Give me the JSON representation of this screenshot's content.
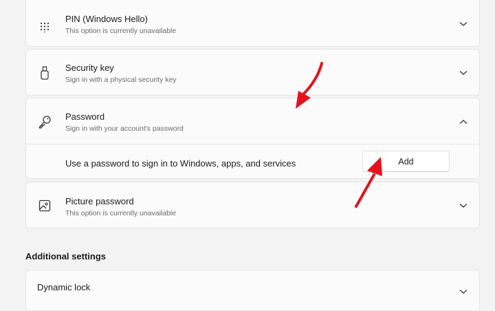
{
  "sign_in_options": [
    {
      "title": "PIN (Windows Hello)",
      "subtitle": "This option is currently unavailable",
      "icon": "keypad-icon",
      "expanded": false
    },
    {
      "title": "Security key",
      "subtitle": "Sign in with a physical security key",
      "icon": "usb-key-icon",
      "expanded": false
    },
    {
      "title": "Password",
      "subtitle": "Sign in with your account's password",
      "icon": "key-icon",
      "expanded": true
    },
    {
      "title": "Picture password",
      "subtitle": "This option is currently unavailable",
      "icon": "picture-icon",
      "expanded": false
    }
  ],
  "password_panel": {
    "description": "Use a password to sign in to Windows, apps, and services",
    "add_label": "Add"
  },
  "additional_settings": {
    "heading": "Additional settings",
    "items": [
      {
        "title": "Dynamic lock"
      }
    ]
  },
  "colors": {
    "background": "#f3f3f3",
    "card": "#fbfbfb",
    "annotation_arrow": "#e5121d"
  }
}
